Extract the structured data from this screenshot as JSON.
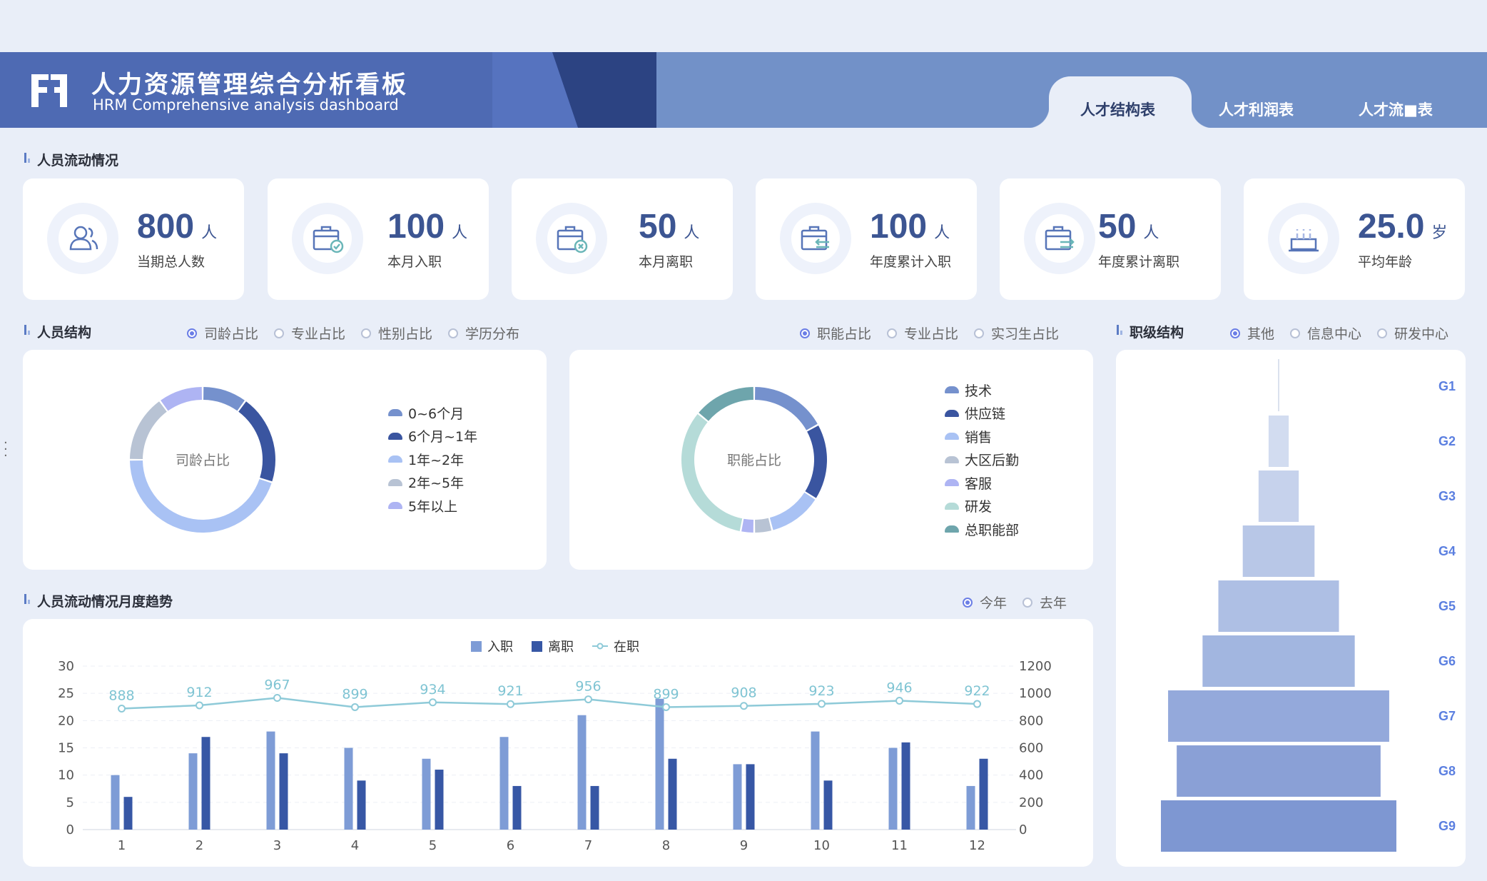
{
  "header": {
    "title_cn": "人力资源管理综合分析看板",
    "title_en": "HRM Comprehensive analysis dashboard",
    "tabs": [
      "人才结构表",
      "人才利润表",
      "人才流■表"
    ]
  },
  "flow_section": {
    "title": "人员流动情况"
  },
  "kpis": [
    {
      "value": "800",
      "unit": "人",
      "label": "当期总人数",
      "icon": "users-icon"
    },
    {
      "value": "100",
      "unit": "人",
      "label": "本月入职",
      "icon": "briefcase-check-icon"
    },
    {
      "value": "50",
      "unit": "人",
      "label": "本月离职",
      "icon": "briefcase-x-icon"
    },
    {
      "value": "100",
      "unit": "人",
      "label": "年度累计入职",
      "icon": "briefcase-in-icon"
    },
    {
      "value": "50",
      "unit": "人",
      "label": "年度累计离职",
      "icon": "briefcase-out-icon"
    },
    {
      "value": "25.0",
      "unit": "岁",
      "label": "平均年龄",
      "icon": "cake-icon"
    }
  ],
  "structure": {
    "title": "人员结构",
    "left_radios": [
      "司龄占比",
      "专业占比",
      "性别占比",
      "学历分布"
    ],
    "right_radios": [
      "职能占比",
      "专业占比",
      "实习生占比"
    ]
  },
  "level": {
    "title": "职级结构",
    "radios": [
      "其他",
      "信息中心",
      "研发中心"
    ],
    "grades": [
      "G1",
      "G2",
      "G3",
      "G4",
      "G5",
      "G6",
      "G7",
      "G8",
      "G9"
    ]
  },
  "trend": {
    "title": "人员流动情况月度趋势",
    "radios": [
      "今年",
      "去年"
    ]
  },
  "colors": {
    "accent": "#6b7ee6",
    "primary": "#3c5592",
    "bar_in": "#7e9cd6",
    "bar_out": "#3757a5",
    "line": "#8ecad8"
  },
  "chart_data": [
    {
      "type": "pie",
      "center_label": "司龄占比",
      "categories": [
        "0~6个月",
        "6个月~1年",
        "1年~2年",
        "2年~5年",
        "5年以上"
      ],
      "values": [
        10,
        20,
        45,
        15,
        10
      ],
      "colors": [
        "#7591cd",
        "#3a55a0",
        "#a9c2f4",
        "#b8c3d4",
        "#aeb4f3"
      ]
    },
    {
      "type": "pie",
      "center_label": "职能占比",
      "categories": [
        "技术",
        "供应链",
        "销售",
        "大区后勤",
        "客服",
        "研发",
        "总职能部"
      ],
      "values": [
        17,
        17,
        12,
        4,
        3,
        33,
        14
      ],
      "colors": [
        "#7591cd",
        "#3a55a0",
        "#a9c2f4",
        "#b8c3d4",
        "#aeb4f3",
        "#b5dbd8",
        "#6ea5ac"
      ]
    },
    {
      "type": "bar",
      "categories": [
        "1",
        "2",
        "3",
        "4",
        "5",
        "6",
        "7",
        "8",
        "9",
        "10",
        "11",
        "12"
      ],
      "series": [
        {
          "name": "入职",
          "values": [
            10,
            14,
            18,
            15,
            13,
            17,
            21,
            24,
            12,
            18,
            15,
            8
          ]
        },
        {
          "name": "离职",
          "values": [
            6,
            17,
            14,
            9,
            11,
            8,
            8,
            13,
            12,
            9,
            16,
            13
          ]
        },
        {
          "name": "在职",
          "type": "line",
          "axis": "right",
          "values": [
            888,
            912,
            967,
            899,
            934,
            921,
            956,
            899,
            908,
            923,
            946,
            922
          ]
        }
      ],
      "ylim": [
        0,
        30
      ],
      "y_ticks": [
        0,
        5,
        10,
        15,
        20,
        25,
        30
      ],
      "y2lim": [
        0,
        1200
      ],
      "y2_ticks": [
        0,
        200,
        400,
        600,
        800,
        1000,
        1200
      ]
    },
    {
      "type": "bar",
      "orientation": "horizontal-funnel",
      "categories": [
        "G1",
        "G2",
        "G3",
        "G4",
        "G5",
        "G6",
        "G7",
        "G8",
        "G9"
      ],
      "values": [
        0.5,
        7,
        14,
        25,
        42,
        53,
        77,
        71,
        82
      ]
    }
  ]
}
